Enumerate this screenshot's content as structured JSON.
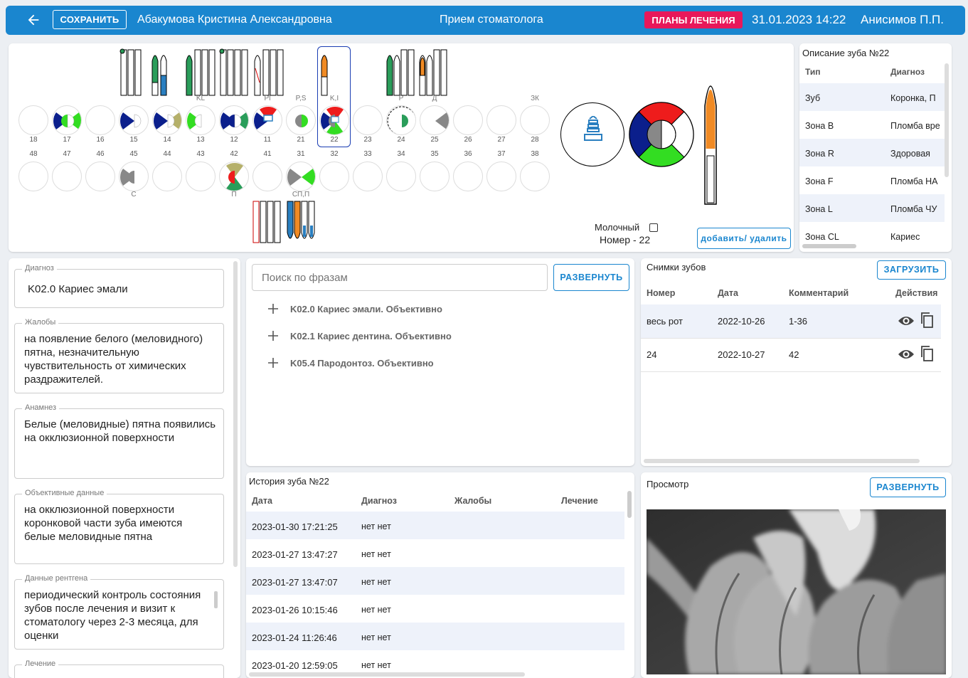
{
  "header": {
    "save_label": "СОХРАНИТЬ",
    "patient_name": "Абакумова Кристина Александровна",
    "page_title": "Прием стоматолога",
    "plans_label": "ПЛАНЫ ЛЕЧЕНИЯ",
    "datetime": "31.01.2023 14:22",
    "doctor": "Анисимов П.П.",
    "colors": {
      "bar": "#1a86cf",
      "plans": "#e8185a"
    }
  },
  "chart": {
    "upper_numbers": [
      "18",
      "17",
      "16",
      "15",
      "14",
      "13",
      "12",
      "11",
      "21",
      "22",
      "23",
      "24",
      "25",
      "26",
      "27",
      "28"
    ],
    "lower_numbers": [
      "48",
      "47",
      "46",
      "45",
      "44",
      "43",
      "42",
      "41",
      "31",
      "32",
      "33",
      "34",
      "35",
      "36",
      "37",
      "38"
    ],
    "upper_labels": {
      "13": "KL",
      "11": "Pl",
      "21": "P,S",
      "22": "K,I",
      "24": "P",
      "25": "Д",
      "28": "ЗК"
    },
    "lower_labels": {
      "45": "С",
      "42": "П",
      "31": "СП,П"
    },
    "selected_tooth": "22",
    "milk_label": "Молочный",
    "number_label": "Номер - 22",
    "add_remove_label": "добавить/ удалить"
  },
  "tooth_desc": {
    "title": "Описание зуба №22",
    "headers": [
      "Тип",
      "Диагноз"
    ],
    "rows": [
      {
        "type": "Зуб",
        "diag": "Коронка, П"
      },
      {
        "type": "Зона B",
        "diag": "Пломба вре"
      },
      {
        "type": "Зона R",
        "diag": "Здоровая"
      },
      {
        "type": "Зона F",
        "diag": "Пломба НА"
      },
      {
        "type": "Зона L",
        "diag": "Пломба ЧУ"
      },
      {
        "type": "Зона CL",
        "diag": "Кариес"
      }
    ]
  },
  "fields": {
    "diagnosis": {
      "label": "Диагноз",
      "value": "K02.0 Кариес эмали"
    },
    "complaints": {
      "label": "Жалобы",
      "value": "на появление белого (меловидного) пятна, незначительную чувствительность от химических раздражителей."
    },
    "anamnesis": {
      "label": "Анамнез",
      "value": " Белые (меловидные) пятна появились на окклюзионной поверхности"
    },
    "objective": {
      "label": "Объективные данные",
      "value": " на окклюзионной поверхности коронковой части зуба имеются белые меловидные пятна"
    },
    "xray": {
      "label": "Данные рентгена",
      "value": "периодический контроль состояния зубов после лечения и визит к стоматологу через 2-3 месяца, для оценки"
    },
    "treatment": {
      "label": "Лечение",
      "value": ""
    }
  },
  "search": {
    "placeholder": "Поиск по фразам",
    "expand_label": "РАЗВЕРНУТЬ",
    "phrases": [
      "K02.0 Кариес эмали. Объективно",
      "K02.1 Кариес дентина. Объективно",
      "K05.4 Пародонтоз. Объективно"
    ]
  },
  "photos": {
    "title": "Снимки зубов",
    "upload_label": "ЗАГРУЗИТЬ",
    "headers": [
      "Номер",
      "Дата",
      "Комментарий",
      "Действия"
    ],
    "rows": [
      {
        "num": "весь рот",
        "date": "2022-10-26",
        "comment": "1-36"
      },
      {
        "num": "24",
        "date": "2022-10-27",
        "comment": "42"
      }
    ]
  },
  "history": {
    "title": "История зуба №22",
    "headers": [
      "Дата",
      "Диагноз",
      "Жалобы",
      "Лечение"
    ],
    "rows": [
      {
        "date": "2023-01-30 17:21:25",
        "diag": "нет нет"
      },
      {
        "date": "2023-01-27 13:47:27",
        "diag": "нет нет"
      },
      {
        "date": "2023-01-27 13:47:07",
        "diag": "нет нет"
      },
      {
        "date": "2023-01-26 10:15:46",
        "diag": "нет нет"
      },
      {
        "date": "2023-01-24 11:26:46",
        "diag": "нет нет"
      },
      {
        "date": "2023-01-20 12:59:05",
        "diag": "нет нет"
      }
    ]
  },
  "preview": {
    "title": "Просмотр",
    "expand_label": "РАЗВЕРНУТЬ"
  },
  "icons": [
    "back-arrow-icon",
    "plus-icon",
    "eye-icon",
    "copy-icon",
    "implant-icon"
  ]
}
